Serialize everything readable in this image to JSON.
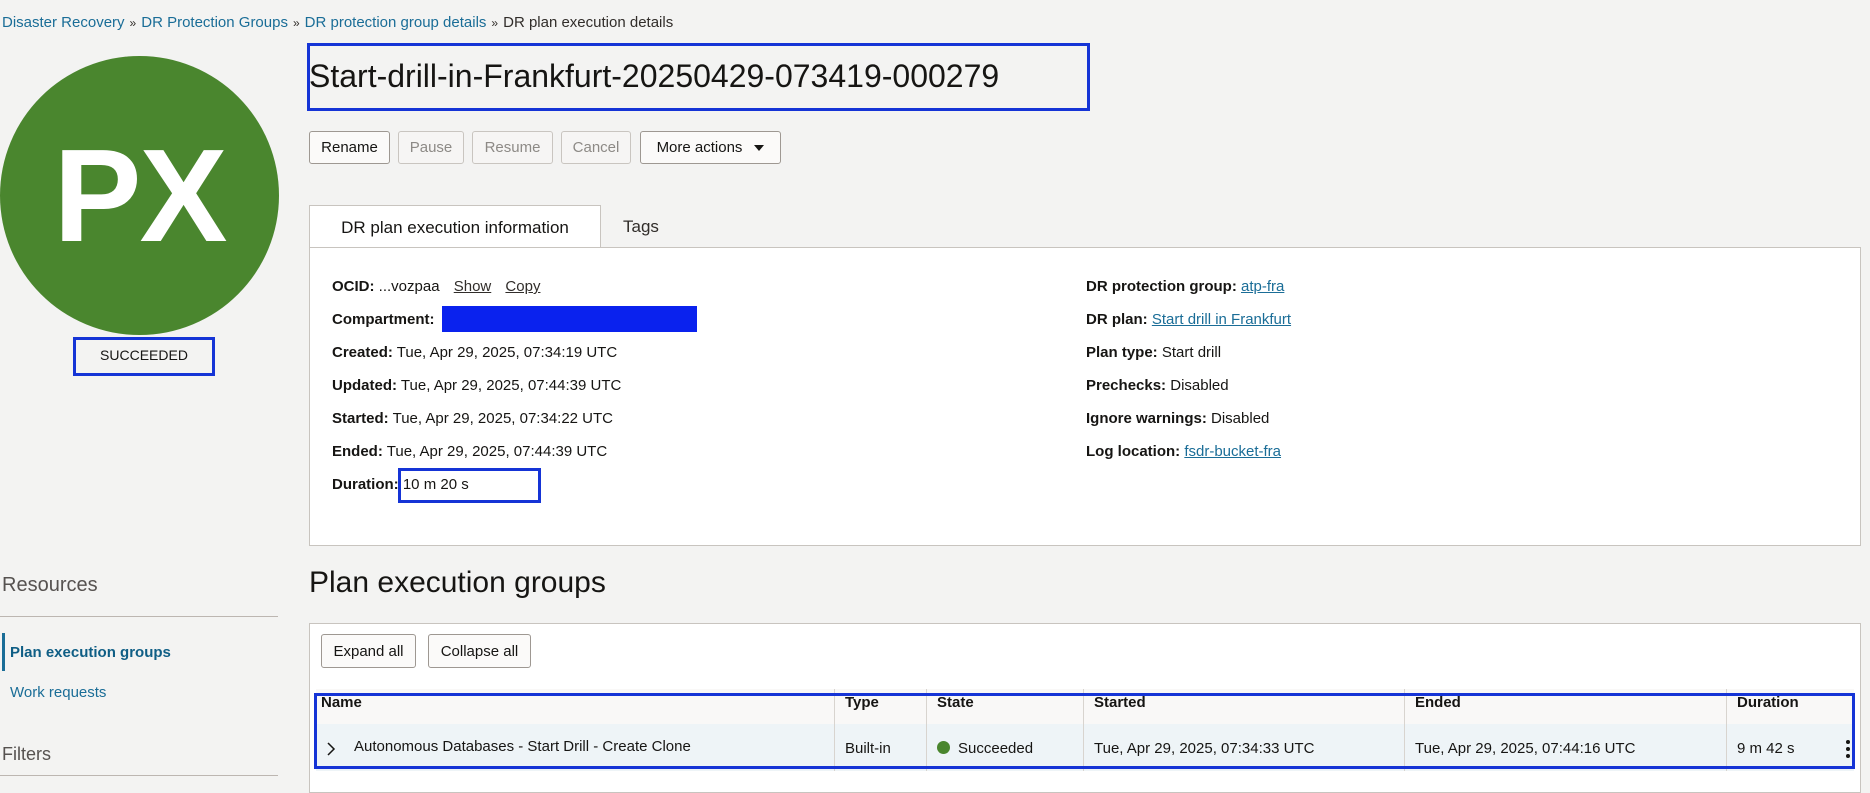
{
  "breadcrumb": {
    "items": [
      "Disaster Recovery",
      "DR Protection Groups",
      "DR protection group details"
    ],
    "current": "DR plan execution details",
    "separator": "»"
  },
  "avatar": {
    "initials": "PX",
    "color": "#4a862e"
  },
  "status": "SUCCEEDED",
  "title": "Start-drill-in-Frankfurt-20250429-073419-000279",
  "actions": {
    "rename": "Rename",
    "pause": "Pause",
    "resume": "Resume",
    "cancel": "Cancel",
    "more": "More actions"
  },
  "tabs": {
    "info": "DR plan execution information",
    "tags": "Tags"
  },
  "info_left": {
    "ocid_label": "OCID:",
    "ocid_value": "...vozpaa",
    "show": "Show",
    "copy": "Copy",
    "compartment_label": "Compartment:",
    "created_label": "Created:",
    "created_value": "Tue, Apr 29, 2025, 07:34:19 UTC",
    "updated_label": "Updated:",
    "updated_value": "Tue, Apr 29, 2025, 07:44:39 UTC",
    "started_label": "Started:",
    "started_value": "Tue, Apr 29, 2025, 07:34:22 UTC",
    "ended_label": "Ended:",
    "ended_value": "Tue, Apr 29, 2025, 07:44:39 UTC",
    "duration_label": "Duration:",
    "duration_value": "10 m 20 s"
  },
  "info_right": {
    "pg_label": "DR protection group:",
    "pg_value": "atp-fra",
    "plan_label": "DR plan:",
    "plan_value": "Start drill in Frankfurt",
    "type_label": "Plan type:",
    "type_value": "Start drill",
    "prechecks_label": "Prechecks:",
    "prechecks_value": "Disabled",
    "ignore_label": "Ignore warnings:",
    "ignore_value": "Disabled",
    "log_label": "Log location:",
    "log_value": "fsdr-bucket-fra"
  },
  "sidebar": {
    "resources": "Resources",
    "items": [
      "Plan execution groups",
      "Work requests"
    ],
    "filters": "Filters"
  },
  "section_title": "Plan execution groups",
  "table": {
    "expand_all": "Expand all",
    "collapse_all": "Collapse all",
    "headers": [
      "Name",
      "Type",
      "State",
      "Started",
      "Ended",
      "Duration"
    ],
    "rows": [
      {
        "name": "Autonomous Databases - Start Drill - Create Clone",
        "type": "Built-in",
        "state": "Succeeded",
        "started": "Tue, Apr 29, 2025, 07:34:33 UTC",
        "ended": "Tue, Apr 29, 2025, 07:44:16 UTC",
        "duration": "9 m 42 s"
      }
    ]
  },
  "colors": {
    "highlight": "#1534d6",
    "redaction": "#0a22ee",
    "success": "#4a862e",
    "link": "#1a6d97"
  }
}
